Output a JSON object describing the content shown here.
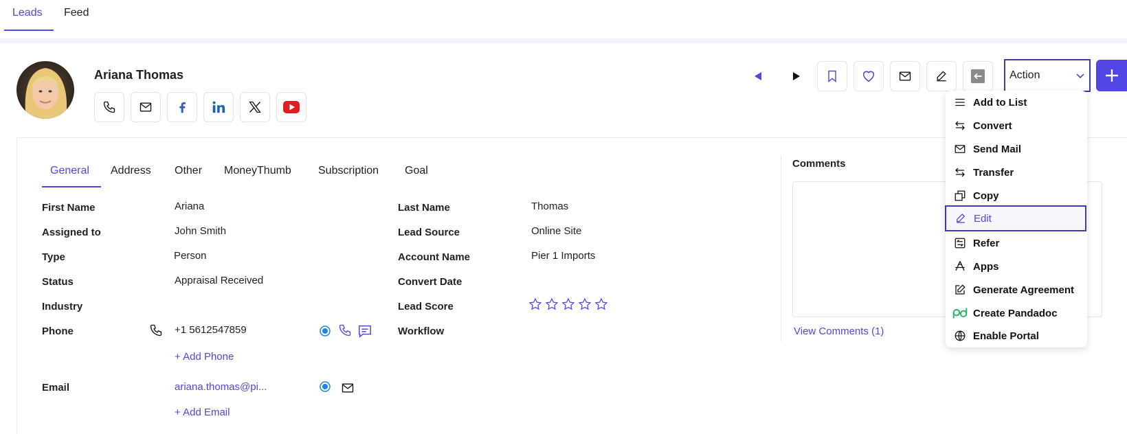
{
  "colors": {
    "accent": "#4f46e5",
    "radio": "#1e88e5",
    "star": "#5046e5"
  },
  "top_tabs": [
    {
      "label": "Leads",
      "active": true
    },
    {
      "label": "Feed",
      "active": false
    }
  ],
  "lead": {
    "name": "Ariana Thomas",
    "social_icons": [
      "phone-icon",
      "mail-icon",
      "facebook-icon",
      "linkedin-icon",
      "x-icon",
      "youtube-icon"
    ]
  },
  "toolbar": {
    "icons": [
      "prev-icon",
      "next-icon",
      "bookmark-icon",
      "heart-icon",
      "mail-icon",
      "edit-icon",
      "back-icon"
    ],
    "action_label": "Action",
    "plus_icon": "plus-icon"
  },
  "sub_tabs": [
    {
      "label": "General",
      "active": true
    },
    {
      "label": "Address"
    },
    {
      "label": "Other"
    },
    {
      "label": "MoneyThumb"
    },
    {
      "label": "Subscription"
    },
    {
      "label": "Goal"
    }
  ],
  "fields_left": [
    {
      "label": "First Name",
      "value": "Ariana"
    },
    {
      "label": "Assigned to",
      "value": "John Smith"
    },
    {
      "label": "Type",
      "value": "Person"
    },
    {
      "label": "Status",
      "value": "Appraisal Received"
    },
    {
      "label": "Industry",
      "value": ""
    },
    {
      "label": "Phone",
      "value": "+1 5612547859"
    }
  ],
  "add_phone": "+ Add Phone",
  "email": {
    "label": "Email",
    "value": "ariana.thomas@pi...",
    "add": "+ Add Email"
  },
  "fields_right": [
    {
      "label": "Last Name",
      "value": "Thomas"
    },
    {
      "label": "Lead Source",
      "value": "Online Site"
    },
    {
      "label": "Account Name",
      "value": "Pier 1 Imports"
    },
    {
      "label": "Convert Date",
      "value": ""
    },
    {
      "label": "Lead Score",
      "value": ""
    },
    {
      "label": "Workflow",
      "value": ""
    }
  ],
  "lead_score_stars": {
    "filled": 0,
    "total": 5
  },
  "comments": {
    "title": "Comments",
    "view_link": "View Comments (1)"
  },
  "action_menu": [
    {
      "label": "Add to List",
      "icon": "list-icon"
    },
    {
      "label": "Convert",
      "icon": "convert-icon"
    },
    {
      "label": "Send Mail",
      "icon": "mail-icon"
    },
    {
      "label": "Transfer",
      "icon": "transfer-icon"
    },
    {
      "label": "Copy",
      "icon": "copy-icon"
    },
    {
      "label": "Edit",
      "icon": "edit-icon",
      "selected": true
    },
    {
      "label": "Refer",
      "icon": "refer-icon"
    },
    {
      "label": "Apps",
      "icon": "apps-icon"
    },
    {
      "label": "Generate Agreement",
      "icon": "agreement-icon"
    },
    {
      "label": "Create Pandadoc",
      "icon": "pandadoc-icon"
    },
    {
      "label": "Enable Portal",
      "icon": "globe-icon"
    }
  ]
}
